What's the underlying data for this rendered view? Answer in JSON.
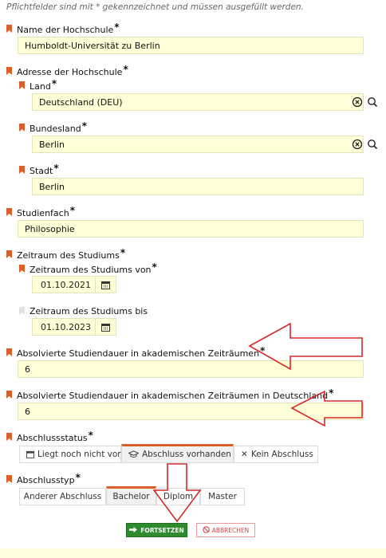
{
  "note": "Pflichtfelder sind mit * gekennzeichnet und müssen ausgefüllt werden.",
  "required_mark": "*",
  "university": {
    "label": "Name der Hochschule",
    "value": "Humboldt-Universität zu Berlin"
  },
  "address": {
    "label": "Adresse der Hochschule",
    "country": {
      "label": "Land",
      "value": "Deutschland (DEU)"
    },
    "state": {
      "label": "Bundesland",
      "value": "Berlin"
    },
    "city": {
      "label": "Stadt",
      "value": "Berlin"
    }
  },
  "subject": {
    "label": "Studienfach",
    "value": "Philosophie"
  },
  "period": {
    "label": "Zeitraum des Studiums",
    "from": {
      "label": "Zeitraum des Studiums von",
      "value": "01.10.2021"
    },
    "to": {
      "label": "Zeitraum des Studiums bis",
      "value": "01.10.2023"
    }
  },
  "duration": {
    "label": "Absolvierte Studiendauer in akademischen Zeiträumen",
    "value": "6"
  },
  "duration_de": {
    "label": "Absolvierte Studiendauer in akademischen Zeiträumen in Deutschland",
    "value": "6"
  },
  "degree_status": {
    "label": "Abschlussstatus",
    "options": [
      "Liegt noch nicht vor",
      "Abschluss vorhanden",
      "Kein Abschluss"
    ],
    "selected": "Abschluss vorhanden"
  },
  "degree_type": {
    "label": "Abschlusstyp",
    "options": [
      "Anderer Abschluss",
      "Bachelor",
      "Diplom",
      "Master"
    ],
    "selected": "Bachelor"
  },
  "actions": {
    "continue": "FORTSETZEN",
    "cancel": "ABBRECHEN"
  },
  "colors": {
    "required_marker": "#d9602a",
    "field_bg": "#ffffd8",
    "continue_bg": "#2e8b2e",
    "cancel_text": "#d04545",
    "annotation_arrow": "#d42a2a"
  },
  "icons": [
    "clear-icon",
    "search-icon",
    "calendar-icon",
    "graduation-cap-icon",
    "close-icon",
    "arrow-right-icon",
    "ban-icon"
  ]
}
